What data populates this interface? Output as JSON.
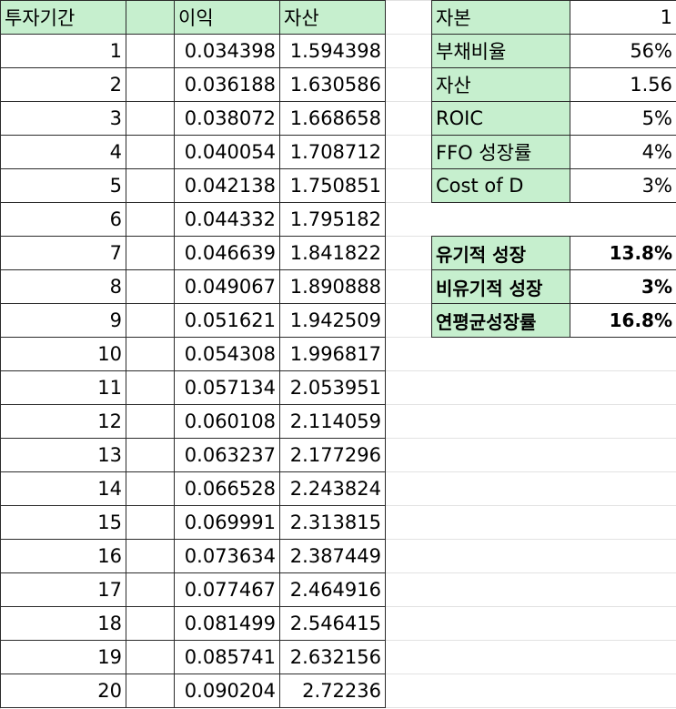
{
  "left_table": {
    "headers": [
      "투자기간",
      "",
      "이익",
      "자산"
    ],
    "rows": [
      [
        "1",
        "",
        "0.034398",
        "1.594398"
      ],
      [
        "2",
        "",
        "0.036188",
        "1.630586"
      ],
      [
        "3",
        "",
        "0.038072",
        "1.668658"
      ],
      [
        "4",
        "",
        "0.040054",
        "1.708712"
      ],
      [
        "5",
        "",
        "0.042138",
        "1.750851"
      ],
      [
        "6",
        "",
        "0.044332",
        "1.795182"
      ],
      [
        "7",
        "",
        "0.046639",
        "1.841822"
      ],
      [
        "8",
        "",
        "0.049067",
        "1.890888"
      ],
      [
        "9",
        "",
        "0.051621",
        "1.942509"
      ],
      [
        "10",
        "",
        "0.054308",
        "1.996817"
      ],
      [
        "11",
        "",
        "0.057134",
        "2.053951"
      ],
      [
        "12",
        "",
        "0.060108",
        "2.114059"
      ],
      [
        "13",
        "",
        "0.063237",
        "2.177296"
      ],
      [
        "14",
        "",
        "0.066528",
        "2.243824"
      ],
      [
        "15",
        "",
        "0.069991",
        "2.313815"
      ],
      [
        "16",
        "",
        "0.073634",
        "2.387449"
      ],
      [
        "17",
        "",
        "0.077467",
        "2.464916"
      ],
      [
        "18",
        "",
        "0.081499",
        "2.546415"
      ],
      [
        "19",
        "",
        "0.085741",
        "2.632156"
      ],
      [
        "20",
        "",
        "0.090204",
        "2.72236"
      ]
    ]
  },
  "params": [
    {
      "label": "자본",
      "value": "1"
    },
    {
      "label": "부채비율",
      "value": "56%"
    },
    {
      "label": "자산",
      "value": "1.56"
    },
    {
      "label": "ROIC",
      "value": "5%"
    },
    {
      "label": "FFO 성장률",
      "value": "4%"
    },
    {
      "label": "Cost of D",
      "value": "3%"
    }
  ],
  "results": [
    {
      "label": "유기적 성장",
      "value": "13.8%"
    },
    {
      "label": "비유기적 성장",
      "value": "3%"
    },
    {
      "label": "연평균성장률",
      "value": "16.8%"
    }
  ],
  "colors": {
    "header_fill": "#c6efce",
    "border": "#2b2b2b",
    "gridline": "#e2e2e2"
  }
}
